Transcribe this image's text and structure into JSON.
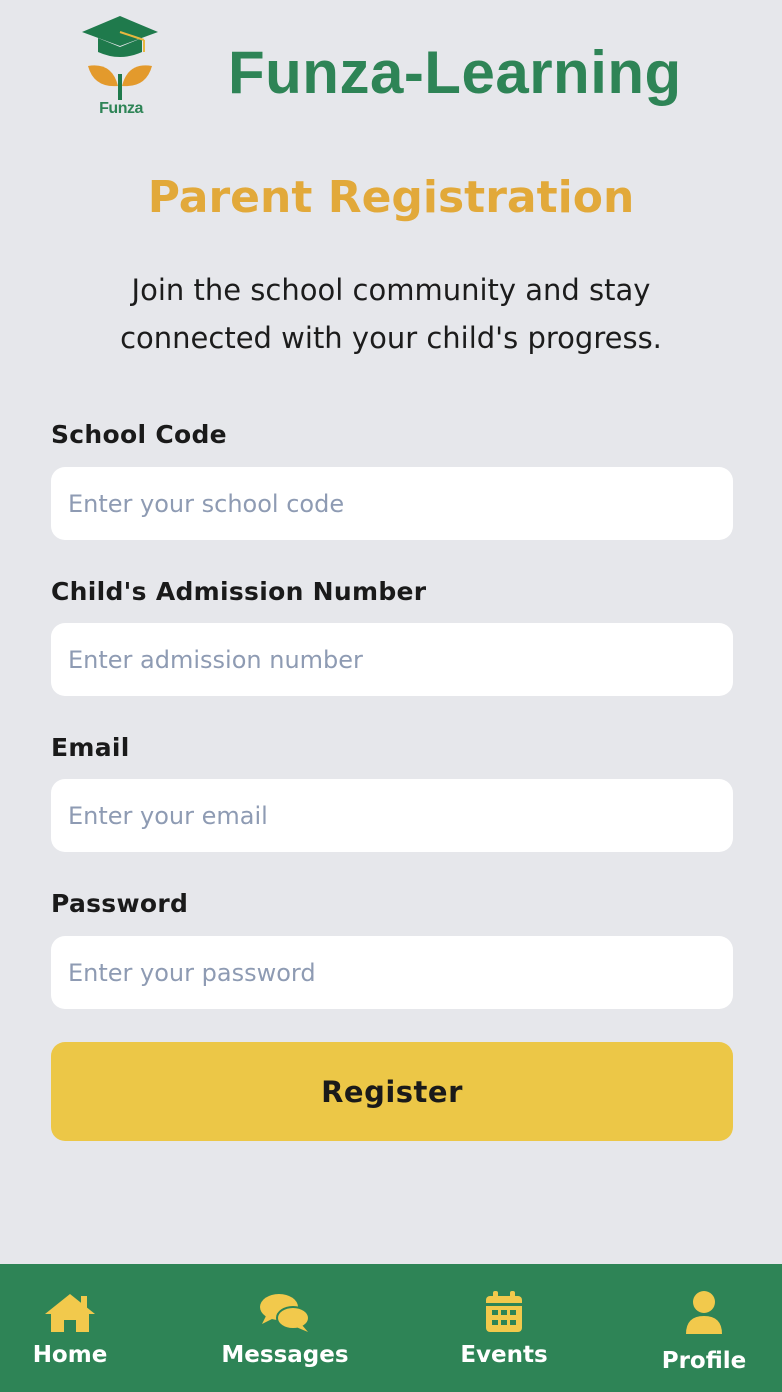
{
  "header": {
    "logo_text": "Funza",
    "app_title": "Funza-Learning"
  },
  "main": {
    "title": "Parent Registration",
    "subtitle_line1": "Join the school community and stay",
    "subtitle_line2": "connected with your child's progress."
  },
  "form": {
    "fields": [
      {
        "label": "School Code",
        "placeholder": "Enter your school code"
      },
      {
        "label": "Child's Admission Number",
        "placeholder": "Enter admission number"
      },
      {
        "label": "Email",
        "placeholder": "Enter your email"
      },
      {
        "label": "Password",
        "placeholder": "Enter your password"
      }
    ],
    "submit_label": "Register"
  },
  "nav": {
    "items": [
      {
        "label": "Home",
        "icon": "home-icon"
      },
      {
        "label": "Messages",
        "icon": "chat-bubbles-icon"
      },
      {
        "label": "Events",
        "icon": "calendar-icon"
      },
      {
        "label": "Profile",
        "icon": "user-icon"
      }
    ]
  },
  "colors": {
    "brand_green": "#2e8456",
    "title_gold": "#e2a93a",
    "button_yellow": "#ecc747",
    "icon_yellow": "#f2c94c",
    "background": "#e6e7eb",
    "placeholder": "#8e9bb3"
  }
}
